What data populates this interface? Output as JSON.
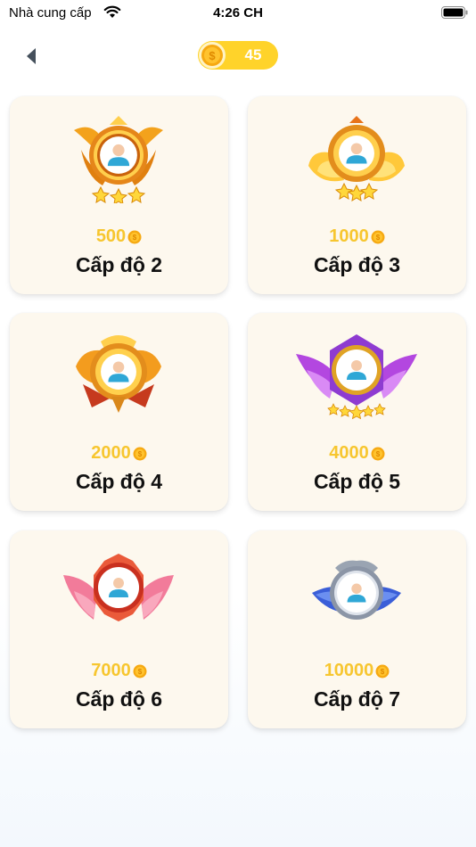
{
  "status_bar": {
    "carrier": "Nhà cung cấp",
    "time": "4:26 CH"
  },
  "header": {
    "coin_balance": "45"
  },
  "colors": {
    "coin_gold": "#f7c62f",
    "pill_bg": "#ffd32a",
    "card_bg": "#fdf8ee"
  },
  "levels": [
    {
      "price": "500",
      "label": "Cấp độ 2",
      "badge_icon": "gold-winged-badge-icon"
    },
    {
      "price": "1000",
      "label": "Cấp độ 3",
      "badge_icon": "gold-feather-badge-icon"
    },
    {
      "price": "2000",
      "label": "Cấp độ 4",
      "badge_icon": "gold-crest-badge-icon"
    },
    {
      "price": "4000",
      "label": "Cấp độ 5",
      "badge_icon": "purple-winged-badge-icon"
    },
    {
      "price": "7000",
      "label": "Cấp độ 6",
      "badge_icon": "pink-winged-badge-icon"
    },
    {
      "price": "10000",
      "label": "Cấp độ 7",
      "badge_icon": "blue-silver-badge-icon"
    }
  ]
}
